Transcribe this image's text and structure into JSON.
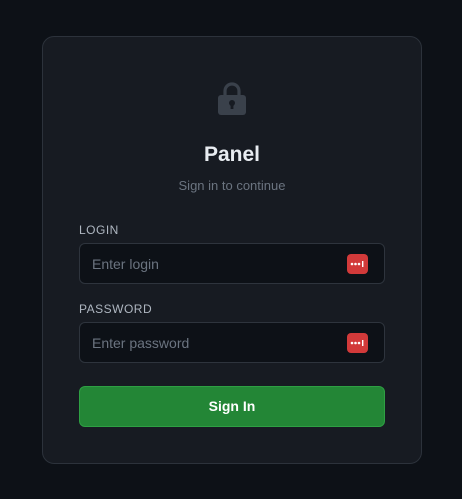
{
  "header": {
    "icon": "lock-icon",
    "title": "Panel",
    "subtitle": "Sign in to continue"
  },
  "form": {
    "login": {
      "label": "LOGIN",
      "value": "",
      "placeholder": "Enter login",
      "icon": "password-manager-icon"
    },
    "password": {
      "label": "PASSWORD",
      "value": "",
      "placeholder": "Enter password",
      "icon": "password-manager-icon"
    },
    "submit_label": "Sign In"
  },
  "colors": {
    "background": "#0d1117",
    "card": "#171b22",
    "accent": "#238636",
    "password_manager": "#d23a3a"
  }
}
